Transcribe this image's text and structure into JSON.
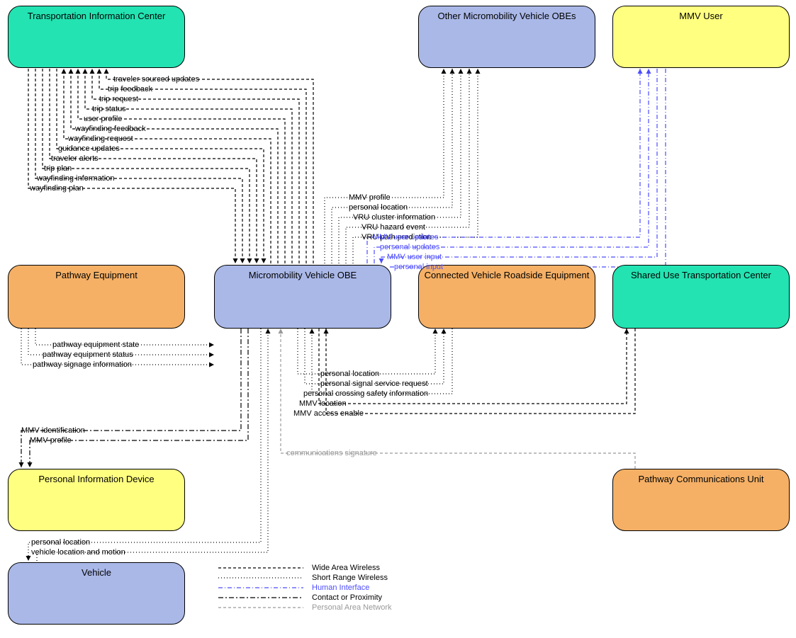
{
  "boxes": {
    "tic": {
      "label": "Transportation Information Center",
      "color": "#23e3b2"
    },
    "omvo": {
      "label": "Other Micromobility Vehicle OBEs",
      "color": "#aab8e8"
    },
    "mmvu": {
      "label": "MMV User",
      "color": "#ffff80"
    },
    "pe": {
      "label": "Pathway Equipment",
      "color": "#f5b066"
    },
    "mvo": {
      "label": "Micromobility Vehicle OBE",
      "color": "#aab8e8"
    },
    "cvre": {
      "label": "Connected Vehicle Roadside Equipment",
      "color": "#f5b066"
    },
    "sutc": {
      "label": "Shared Use Transportation Center",
      "color": "#23e3b2"
    },
    "pid": {
      "label": "Personal Information Device",
      "color": "#ffff80"
    },
    "pcu": {
      "label": "Pathway Communications Unit",
      "color": "#f5b066"
    },
    "veh": {
      "label": "Vehicle",
      "color": "#aab8e8"
    }
  },
  "flows_tic": [
    "traveler sourced updates",
    "trip feedback",
    "trip request",
    "trip status",
    "user profile",
    "wayfinding feedback",
    "wayfinding request",
    "guidance updates",
    "traveler alerts",
    "trip plan",
    "wayfinding information",
    "wayfinding plan"
  ],
  "flows_omvo": [
    "MMV profile",
    "personal location",
    "VRU cluster information",
    "VRU hazard event",
    "VRU path prediction"
  ],
  "flows_mmvu": [
    "MMV user updates",
    "personal updates",
    "MMV user input",
    "personal input"
  ],
  "flows_pe": [
    "pathway equipment state",
    "pathway equipment status",
    "pathway signage information"
  ],
  "flows_cvre": [
    "personal location",
    "personal signal service request",
    "personal crossing safety information"
  ],
  "flows_sutc": [
    "MMV location",
    "MMV access enable"
  ],
  "flows_pid": [
    "MMV identification",
    "MMV profile"
  ],
  "flows_veh": [
    "personal location",
    "vehicle location and motion"
  ],
  "flows_pcu": [
    "communications signature"
  ],
  "legend": {
    "waw": "Wide Area Wireless",
    "srw": "Short Range Wireless",
    "hi": "Human Interface",
    "cp": "Contact or Proximity",
    "pan": "Personal Area Network"
  }
}
